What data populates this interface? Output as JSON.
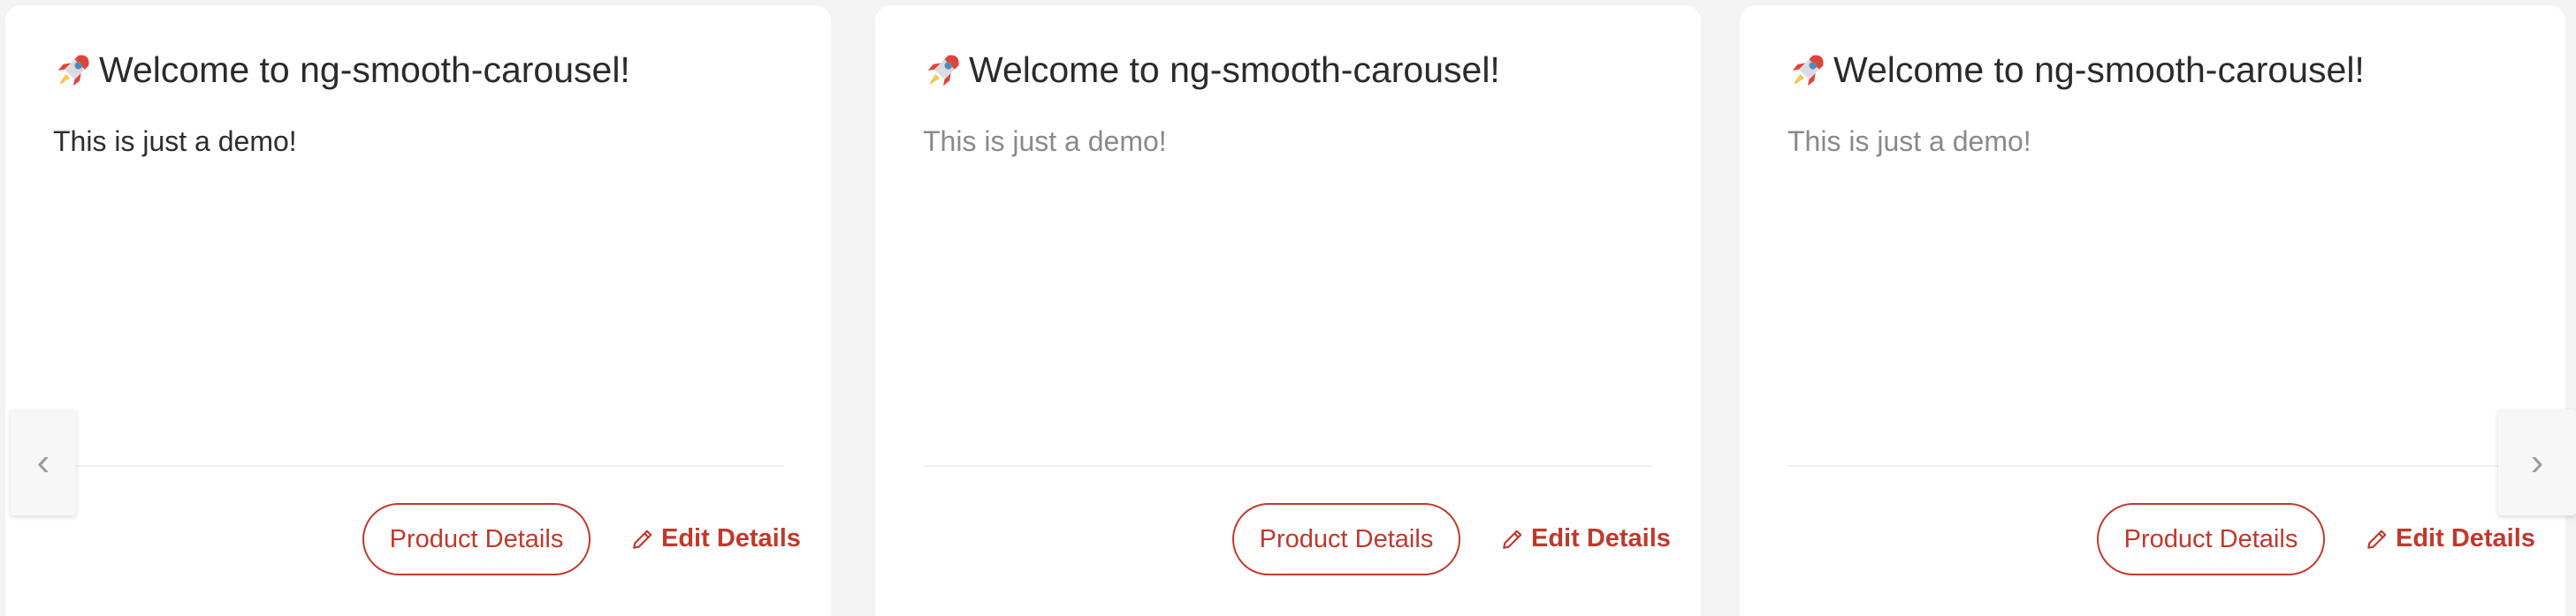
{
  "cards": [
    {
      "title": "Welcome to ng-smooth-carousel!",
      "title_icon": "rocket-icon",
      "description": "This is just a demo!",
      "product_button": "Product Details",
      "edit_button": "Edit Details",
      "edit_icon": "pencil-icon"
    },
    {
      "title": "Welcome to ng-smooth-carousel!",
      "title_icon": "rocket-icon",
      "description": "This is just a demo!",
      "product_button": "Product Details",
      "edit_button": "Edit Details",
      "edit_icon": "pencil-icon"
    },
    {
      "title": "Welcome to ng-smooth-carousel!",
      "title_icon": "rocket-icon",
      "description": "This is just a demo!",
      "product_button": "Product Details",
      "edit_button": "Edit Details",
      "edit_icon": "pencil-icon"
    }
  ],
  "nav": {
    "prev_glyph": "‹",
    "next_glyph": "›"
  },
  "colors": {
    "accent": "#c0392b",
    "background": "#f3f3f3",
    "card": "#ffffff"
  }
}
